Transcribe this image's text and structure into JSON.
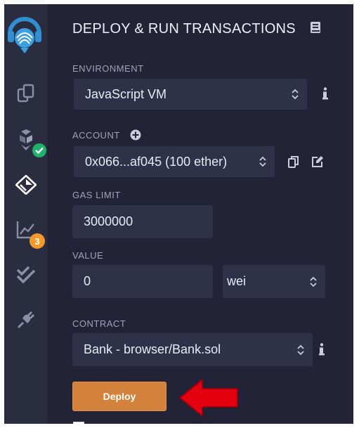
{
  "header": {
    "title": "DEPLOY & RUN TRANSACTIONS",
    "doc_icon": "book-icon"
  },
  "sidebar": {
    "logo": "remix-logo",
    "items": [
      {
        "icon": "files-icon"
      },
      {
        "icon": "compiler-icon",
        "status": "check"
      },
      {
        "icon": "deploy-run-icon",
        "active": true
      },
      {
        "icon": "analysis-icon",
        "badge": "3"
      },
      {
        "icon": "testing-icon"
      },
      {
        "icon": "plugin-icon"
      }
    ]
  },
  "environment": {
    "label": "ENVIRONMENT",
    "value": "JavaScript VM",
    "info_icon": "info-icon"
  },
  "account": {
    "label": "ACCOUNT",
    "value": "0x066...af045 (100 ether)",
    "add_icon": "plus-circle-icon",
    "copy_icon": "copy-icon",
    "edit_icon": "edit-icon"
  },
  "gas_limit": {
    "label": "GAS LIMIT",
    "value": "3000000"
  },
  "value_field": {
    "label": "VALUE",
    "value": "0",
    "unit": "wei"
  },
  "contract": {
    "label": "CONTRACT",
    "value": "Bank - browser/Bank.sol",
    "info_icon": "info-icon"
  },
  "deploy": {
    "label": "Deploy"
  },
  "colors": {
    "panel_bg": "#222336",
    "sidebar_bg": "#2a2c3f",
    "field_bg": "#2e3147",
    "deploy_orange": "#d4823b",
    "annotation_red": "#e3000f",
    "badge_orange": "#f59a2a",
    "check_green": "#1fb26a"
  }
}
